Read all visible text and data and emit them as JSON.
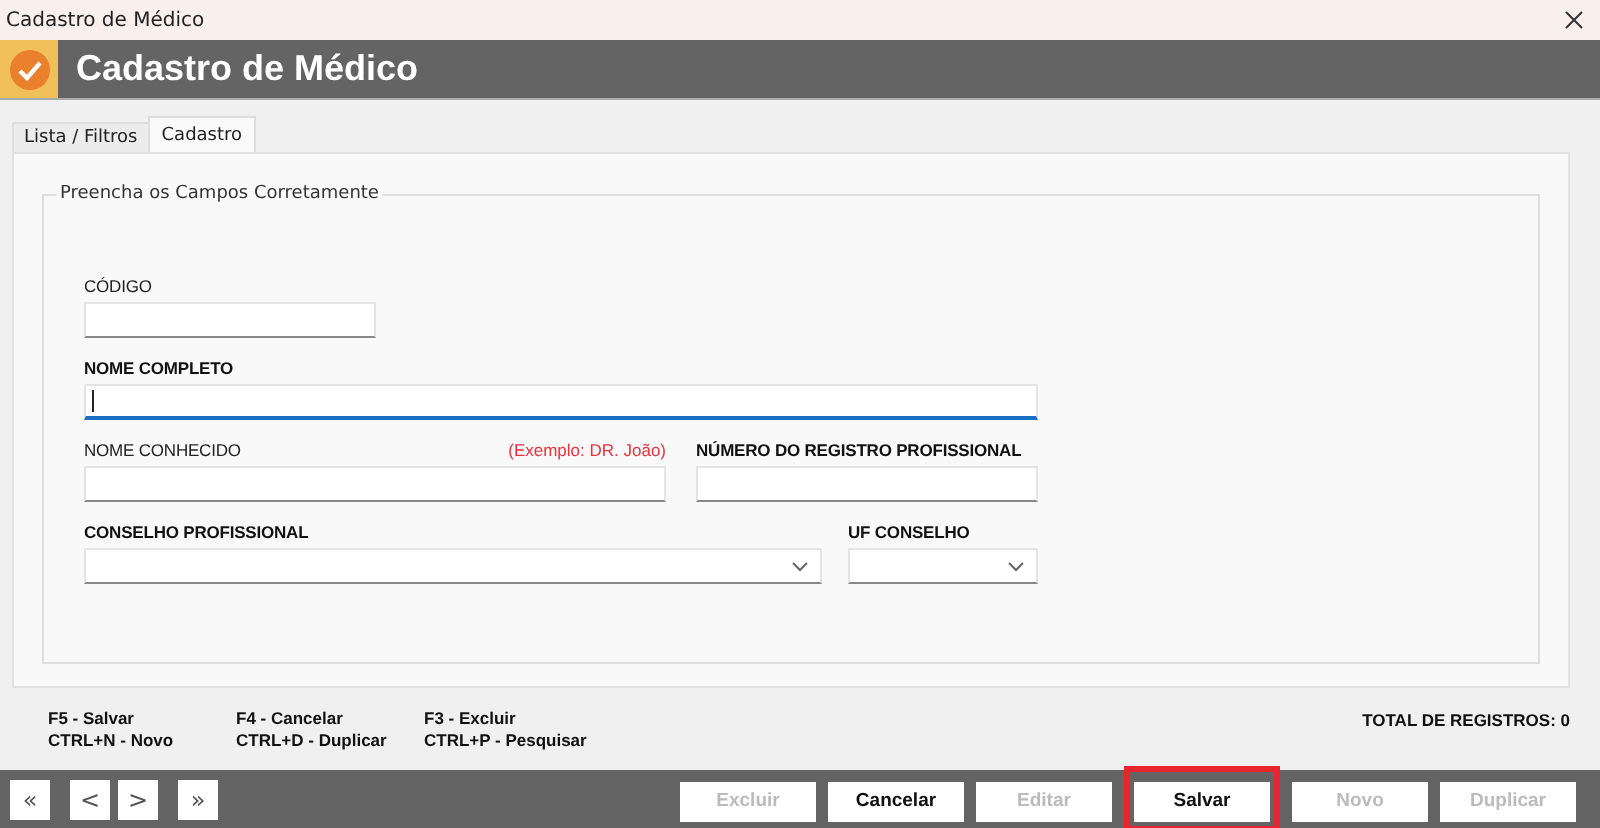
{
  "window": {
    "title": "Cadastro de Médico"
  },
  "header": {
    "title": "Cadastro de Médico"
  },
  "tabs": [
    {
      "label": "Lista / Filtros",
      "selected": false
    },
    {
      "label": "Cadastro",
      "selected": true
    }
  ],
  "group": {
    "title": "Preencha os Campos Corretamente"
  },
  "form_rows": [
    [
      {
        "kind": "text",
        "label": "CÓDIGO",
        "required": false,
        "focused": false
      }
    ],
    [
      {
        "kind": "text",
        "label": "NOME COMPLETO",
        "required": true,
        "focused": true
      }
    ],
    [
      {
        "kind": "text",
        "label": "NOME CONHECIDO",
        "hint": "(Exemplo: DR. João)",
        "required": false,
        "focused": false
      },
      {
        "kind": "text",
        "label": "NÚMERO DO REGISTRO PROFISSIONAL",
        "required": true,
        "focused": false
      }
    ],
    [
      {
        "kind": "select",
        "label": "CONSELHO PROFISSIONAL",
        "required": true
      },
      {
        "kind": "select",
        "label": "UF CONSELHO",
        "required": true
      }
    ]
  ],
  "shortcuts": [
    [
      "F5 - Salvar",
      "CTRL+N - Novo"
    ],
    [
      "F4 - Cancelar",
      "CTRL+D - Duplicar"
    ],
    [
      "F3 - Excluir",
      "CTRL+P - Pesquisar"
    ]
  ],
  "total": "TOTAL DE REGISTROS: 0",
  "nav_buttons": [
    [
      "«"
    ],
    [
      "<",
      ">"
    ],
    [
      "»"
    ]
  ],
  "actions": [
    {
      "label": "Excluir",
      "disabled": true,
      "highlighted": false
    },
    {
      "label": "Cancelar",
      "disabled": false,
      "highlighted": false
    },
    {
      "label": "Editar",
      "disabled": true,
      "highlighted": false
    },
    {
      "label": "Salvar",
      "disabled": false,
      "highlighted": true
    },
    {
      "label": "Novo",
      "disabled": true,
      "highlighted": false
    },
    {
      "label": "Duplicar",
      "disabled": true,
      "highlighted": false
    }
  ]
}
